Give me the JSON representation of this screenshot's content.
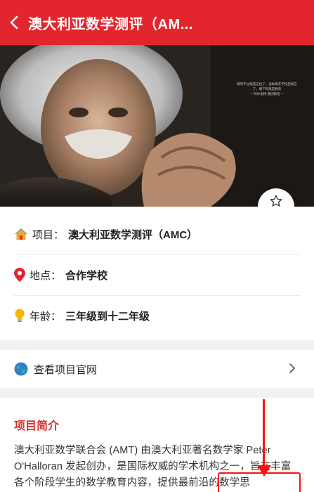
{
  "header": {
    "title": "澳大利亚数学测评（AM..."
  },
  "hero": {
    "caption": [
      "教育不过就是记住了，当你离开学校后就忘了，剩下的就是教育",
      "— 阿尔伯特·爱因斯坦 —"
    ]
  },
  "favorite": {
    "label": "收藏"
  },
  "info": {
    "project": {
      "label": "项目：",
      "value": "澳大利亚数学测评（AMC）"
    },
    "location": {
      "label": "地点：",
      "value": "合作学校"
    },
    "age": {
      "label": "年龄：",
      "value": "三年级到十二年级"
    }
  },
  "site": {
    "label": "查看项目官网"
  },
  "intro": {
    "title": "项目简介",
    "body": "澳大利亚数学联合会 (AMT) 由澳大利亚著名数学家 Peter O'Halloran 发起创办，是国际权威的学术机构之一，旨在丰富各个阶段学生的数学教育内容，提供最前沿的数学思"
  },
  "colors": {
    "brand": "#e3262d",
    "accent": "#d6302b",
    "annotation": "#ff1010"
  }
}
